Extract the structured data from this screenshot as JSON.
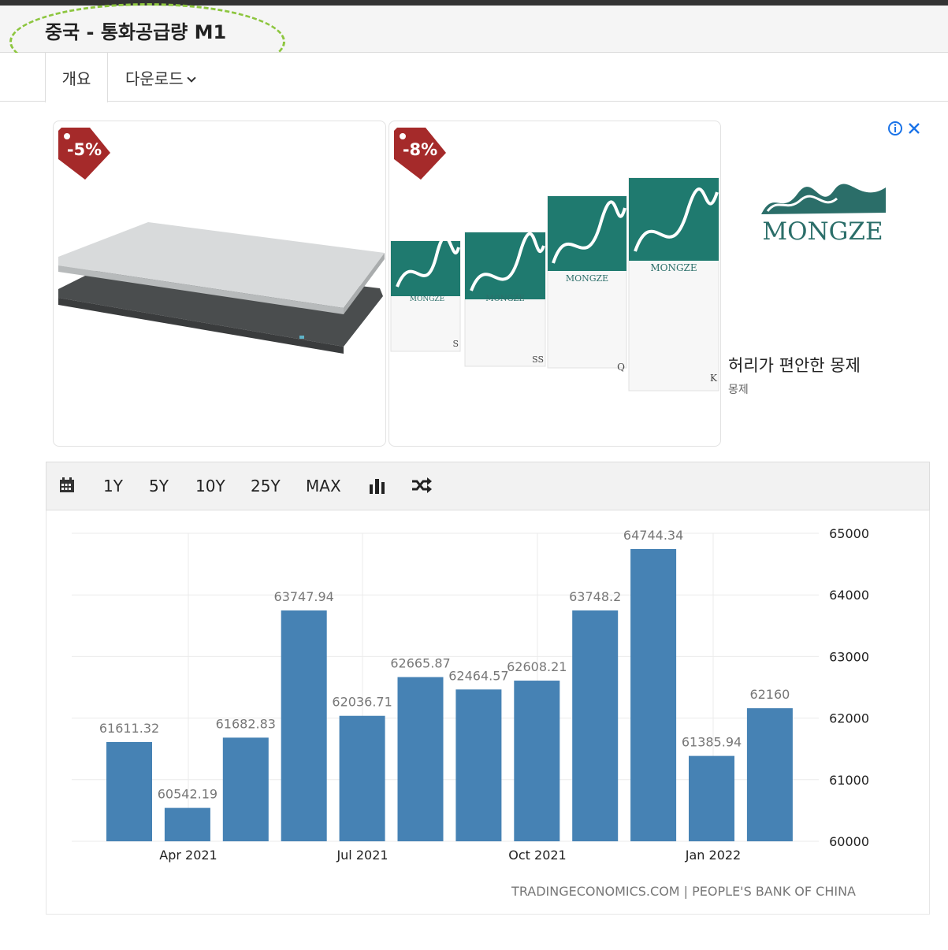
{
  "page": {
    "title": "중국 - 통화공급량 M1",
    "tabs": [
      {
        "label": "개요"
      },
      {
        "label": "다운로드"
      }
    ]
  },
  "ad": {
    "discounts": [
      "-5%",
      "-8%"
    ],
    "brand": "MONGZE",
    "headline": "허리가 편안한 몽제",
    "advertiser": "몽제",
    "product_box_label": "MONGZE",
    "box_sizes": [
      "S",
      "SS",
      "Q",
      "K"
    ],
    "colors": {
      "tag": "#a52a2a",
      "brand": "#2b6e69"
    },
    "icons": [
      "info-icon",
      "close-icon"
    ]
  },
  "toolbar": {
    "calendar_icon": "calendar-icon",
    "ranges": [
      "1Y",
      "5Y",
      "10Y",
      "25Y",
      "MAX"
    ],
    "chart_type_icon": "bar-chart-icon",
    "compare_icon": "shuffle-icon"
  },
  "chart_data": {
    "type": "bar",
    "categories": [
      "2021-03",
      "2021-04",
      "2021-05",
      "2021-06",
      "2021-07",
      "2021-08",
      "2021-09",
      "2021-10",
      "2021-11",
      "2021-12",
      "2022-01",
      "2022-02"
    ],
    "values": [
      61611.32,
      60542.19,
      61682.83,
      63747.94,
      62036.71,
      62665.87,
      62464.57,
      62608.21,
      63748.2,
      64744.34,
      61385.94,
      62160
    ],
    "value_labels": [
      "61611.32",
      "60542.19",
      "61682.83",
      "63747.94",
      "62036.71",
      "62665.87",
      "62464.57",
      "62608.21",
      "63748.2",
      "64744.34",
      "61385.94",
      "62160"
    ],
    "x_ticks": [
      "Apr 2021",
      "Jul 2021",
      "Oct 2021",
      "Jan 2022"
    ],
    "y_ticks": [
      "60000",
      "61000",
      "62000",
      "63000",
      "64000",
      "65000"
    ],
    "ylim": [
      60000,
      65000
    ],
    "grid": true,
    "bar_color": "#4682b4",
    "source": "TRADINGECONOMICS.COM | PEOPLE'S BANK OF CHINA"
  }
}
